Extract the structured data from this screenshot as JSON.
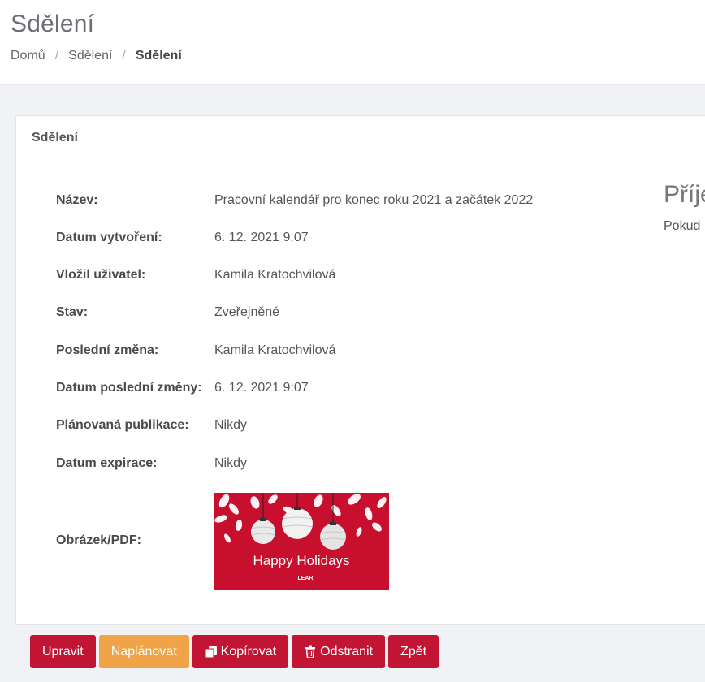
{
  "header": {
    "title": "Sdělení",
    "breadcrumb": [
      "Domů",
      "Sdělení",
      "Sdělení"
    ]
  },
  "card": {
    "title": "Sdělení",
    "details": [
      {
        "label": "Název:",
        "value": "Pracovní kalendář pro konec roku 2021 a začátek 2022"
      },
      {
        "label": "Datum vytvoření:",
        "value": "6. 12. 2021 9:07"
      },
      {
        "label": "Vložil uživatel:",
        "value": "Kamila Kratochvilová"
      },
      {
        "label": "Stav:",
        "value": "Zveřejněné"
      },
      {
        "label": "Poslední změna:",
        "value": "Kamila Kratochvilová"
      },
      {
        "label": "Datum poslední změny:",
        "value": "6. 12. 2021 9:07"
      },
      {
        "label": "Plánovaná publikace:",
        "value": "Nikdy"
      },
      {
        "label": "Datum expirace:",
        "value": "Nikdy"
      }
    ],
    "image_label": "Obrázek/PDF:",
    "image": {
      "caption": "Happy Holidays",
      "brand": "LEAR",
      "background_color": "#c8102e"
    },
    "side": {
      "heading": "Příje",
      "text": "Pokud"
    }
  },
  "actions": {
    "edit": "Upravit",
    "schedule": "Naplánovat",
    "copy": "Kopírovat",
    "delete": "Odstranit",
    "back": "Zpět"
  },
  "colors": {
    "primary": "#c21433",
    "warning": "#f0a347"
  }
}
